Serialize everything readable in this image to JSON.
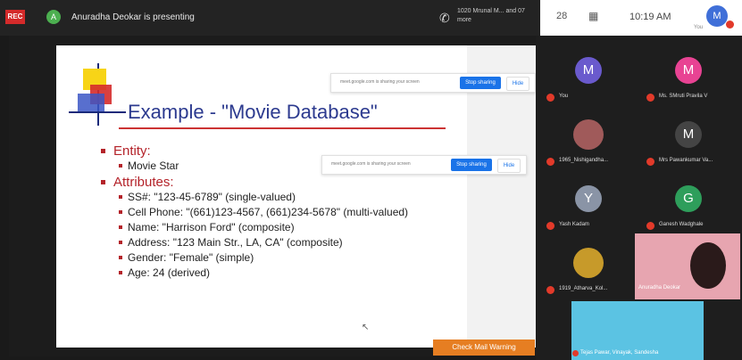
{
  "topbar": {
    "rec_label": "REC",
    "presenter_initial": "A",
    "presenter_text": "Anuradha Deokar is presenting",
    "notification": "1020 Mrunal M... and 07 more"
  },
  "zoom_header": {
    "people_label": "28",
    "time": "10:19 AM",
    "avatar_initial": "M",
    "you_label": "You"
  },
  "slide": {
    "title": "Example - \"Movie Database\"",
    "entity_heading": "Entity:",
    "entity_item": "Movie Star",
    "attributes_heading": "Attributes:",
    "attributes": [
      "SS#: \"123-45-6789\" (single-valued)",
      "Cell Phone: \"(661)123-4567, (661)234-5678\" (multi-valued)",
      "Name: \"Harrison Ford\" (composite)",
      "Address: \"123 Main Str., LA, CA\" (composite)",
      "Gender: \"Female\" (simple)",
      "Age: 24 (derived)"
    ],
    "share_bar_text": "meet.google.com is sharing your screen",
    "stop_sharing": "Stop sharing",
    "hide": "Hide",
    "orange_button": "Check Mail Warning"
  },
  "participants": [
    {
      "initial": "M",
      "name": "You",
      "color": "#6a5acd"
    },
    {
      "initial": "M",
      "name": "Ms. SMruti Pravila V",
      "color": "#e84393"
    },
    {
      "initial": "",
      "name": "1965_Nishigandha...",
      "color": "#a05a5a"
    },
    {
      "initial": "M",
      "name": "Mrs Pawankumar Va...",
      "color": "#444"
    },
    {
      "initial": "Y",
      "name": "Yash Kadam",
      "color": "#8a94a6"
    },
    {
      "initial": "G",
      "name": "Ganesh Wadghale",
      "color": "#2e9e5b"
    },
    {
      "initial": "",
      "name": "1919_Atharva_Kol...",
      "color": "#c79a2a"
    }
  ],
  "video": {
    "name": "Anuradha Deokar"
  },
  "blue_tile": {
    "name": "Tejas Pawar, Vinayak, Sandesha"
  }
}
